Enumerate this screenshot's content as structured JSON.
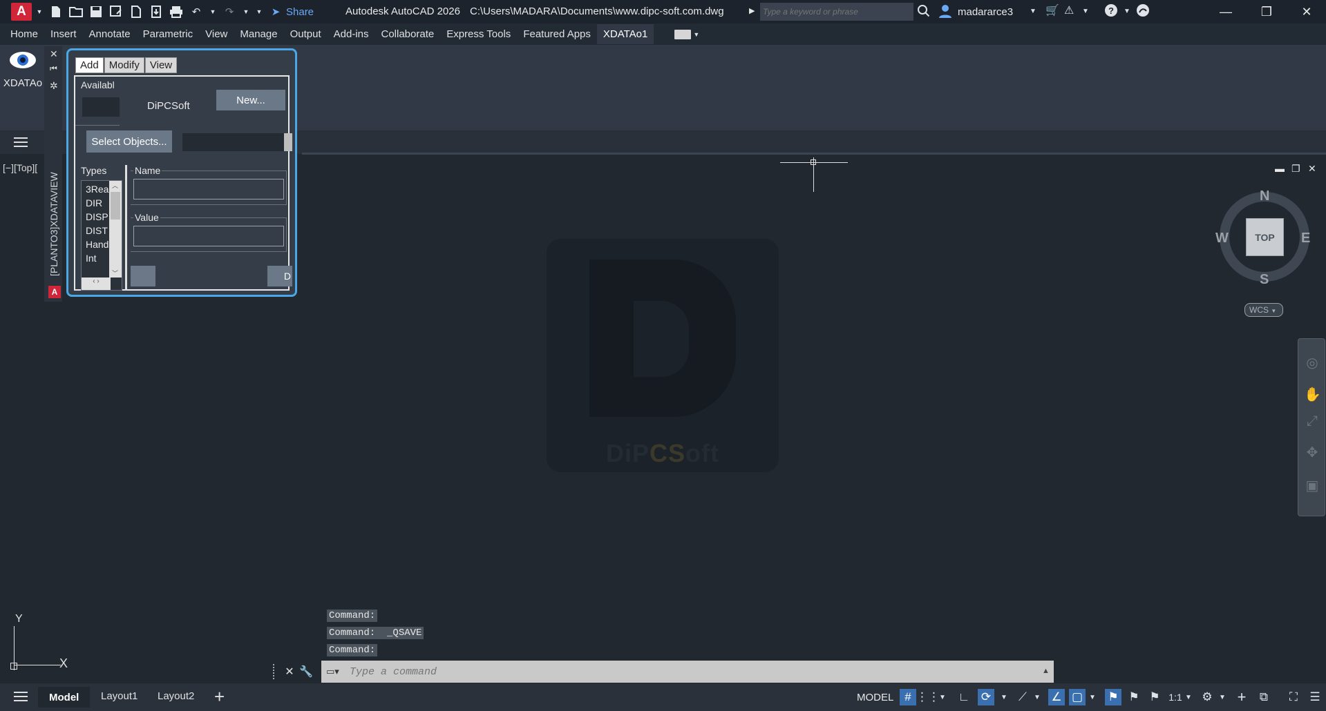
{
  "titlebar": {
    "logo_letter": "A",
    "share_label": "Share",
    "app_title": "Autodesk AutoCAD 2026",
    "file_path": "C:\\Users\\MADARA\\Documents\\www.dipc-soft.com.dwg",
    "search_placeholder": "Type a keyword or phrase",
    "username": "madararce3"
  },
  "ribbon_tabs": [
    "Home",
    "Insert",
    "Annotate",
    "Parametric",
    "View",
    "Manage",
    "Output",
    "Add-ins",
    "Collaborate",
    "Express Tools",
    "Featured Apps",
    "XDATAo1"
  ],
  "ribbon_active_tab": "XDATAo1",
  "ribbon_panel": {
    "button_label": "XDATAo"
  },
  "viewport": {
    "label": "[−][Top][",
    "cube_top": "TOP",
    "compass": {
      "n": "N",
      "s": "S",
      "e": "E",
      "w": "W"
    },
    "wcs": "WCS",
    "ucs": {
      "x": "X",
      "y": "Y"
    }
  },
  "watermark": {
    "letter": "D",
    "text_a": "DiP",
    "text_b": "CS",
    "text_c": "oft"
  },
  "palette": {
    "side_title": "[PLANTO3]XDATAVIEW",
    "tabs": [
      "Add",
      "Modify",
      "View"
    ],
    "active_tab": "Add",
    "available_label": "Availabl",
    "app_name": "DiPCSoft",
    "new_button": "New...",
    "select_objects_button": "Select Objects...",
    "types_label": "Types",
    "types": [
      "3Rea",
      "DIR",
      "DISP",
      "DIST",
      "Hand",
      "Int"
    ],
    "name_label": "Name",
    "value_label": "Value",
    "right_btn_label": "D"
  },
  "command": {
    "history": [
      "Command:",
      "Command:  _QSAVE",
      "Command:"
    ],
    "placeholder": "Type a command"
  },
  "statusbar": {
    "tabs": [
      "Model",
      "Layout1",
      "Layout2"
    ],
    "active_tab": "Model",
    "model_label": "MODEL",
    "scale": "1:1"
  }
}
